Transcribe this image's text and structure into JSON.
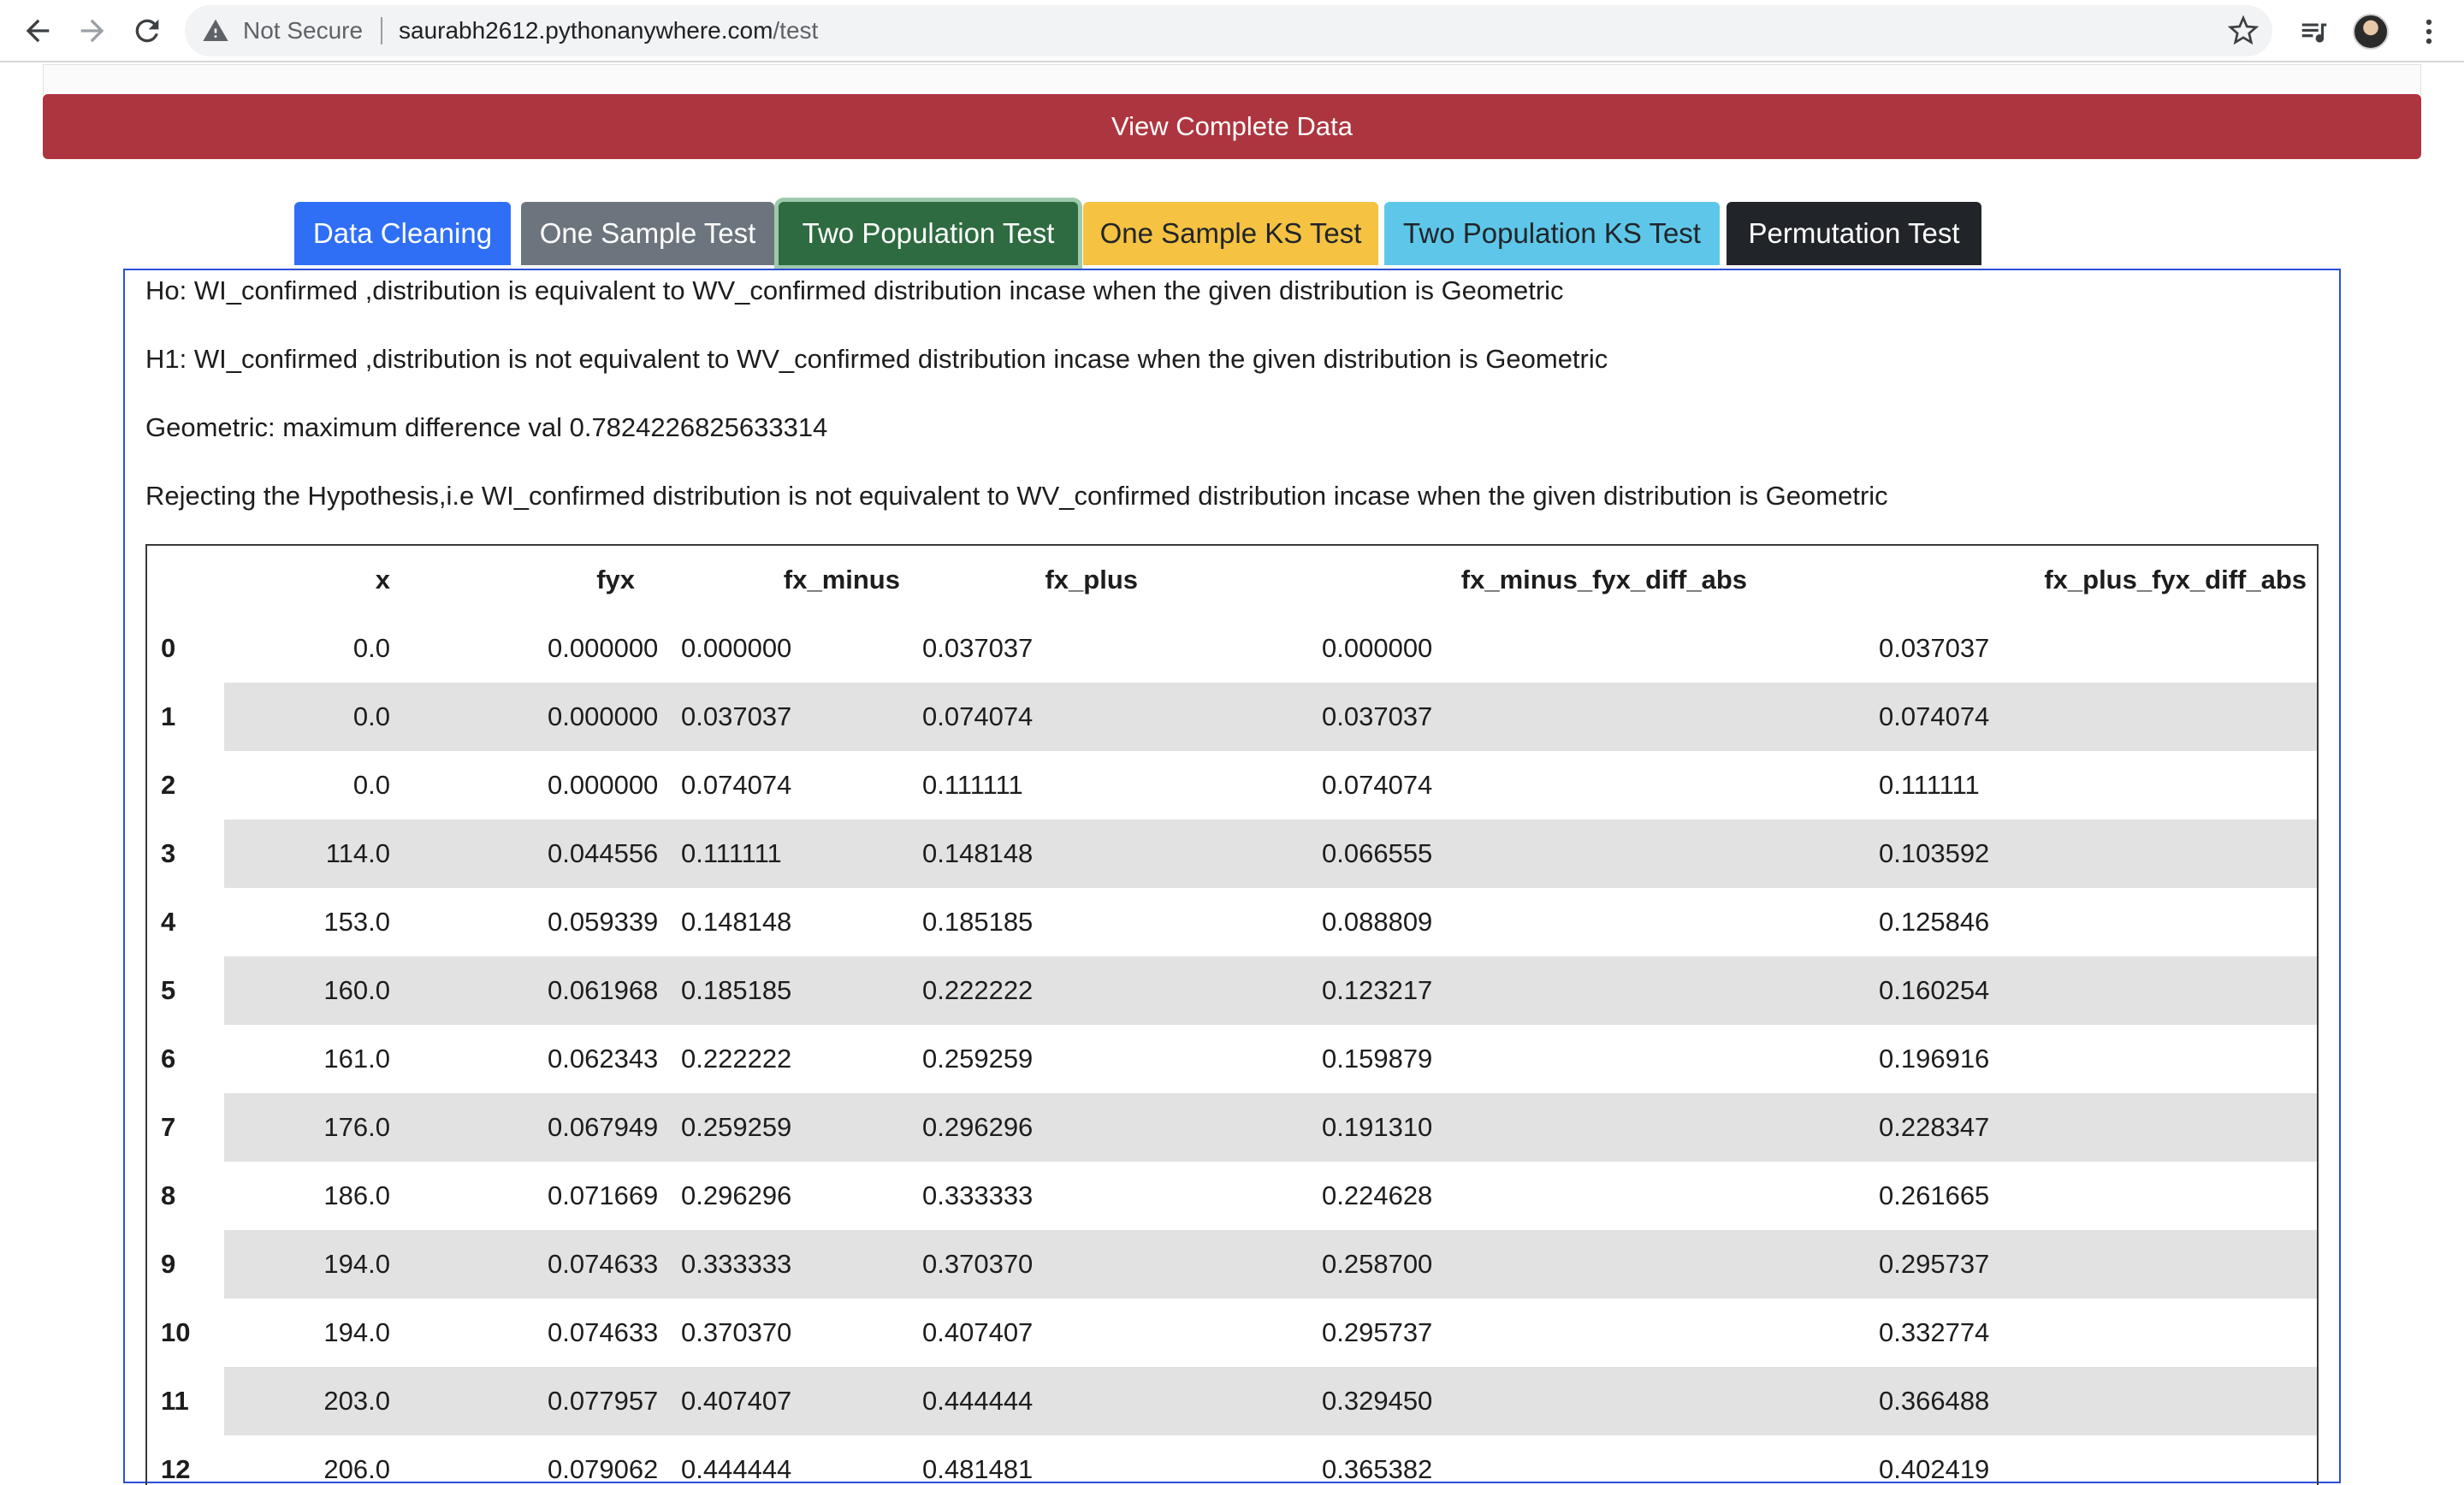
{
  "browser": {
    "not_secure": "Not Secure",
    "url_domain": "saurabh2612.pythonanywhere.com",
    "url_path": "/test",
    "icons": [
      "back-arrow-icon",
      "forward-arrow-icon",
      "reload-icon",
      "warning-icon",
      "star-icon",
      "media-playlist-icon",
      "avatar",
      "more-vert-icon"
    ]
  },
  "page": {
    "view_complete_label": "View Complete Data",
    "tabs": [
      {
        "label": "Data Cleaning",
        "color": "#2f6ff6"
      },
      {
        "label": "One Sample Test",
        "color": "#6c757d"
      },
      {
        "label": "Two Population Test",
        "color": "#2e6b40",
        "active": true
      },
      {
        "label": "One Sample KS Test",
        "color": "#f5c242"
      },
      {
        "label": "Two Population KS Test",
        "color": "#5ec7e9"
      },
      {
        "label": "Permutation Test",
        "color": "#212529"
      }
    ],
    "ho": "Ho: WI_confirmed ,distribution is equivalent to WV_confirmed distribution incase when the given distribution is Geometric",
    "h1": "H1: WI_confirmed ,distribution is not equivalent to WV_confirmed distribution incase when the given distribution is Geometric",
    "geo": "Geometric: maximum difference val 0.7824226825633314",
    "reject": "Rejecting the Hypothesis,i.e WI_confirmed distribution is not equivalent to WV_confirmed distribution incase when the given distribution is Geometric"
  },
  "table": {
    "columns": [
      "",
      "x",
      "fyx",
      "fx_minus",
      "fx_plus",
      "fx_minus_fyx_diff_abs",
      "fx_plus_fyx_diff_abs"
    ],
    "rows": [
      [
        "0",
        "0.0",
        "0.000000",
        "0.000000",
        "0.037037",
        "0.000000",
        "0.037037"
      ],
      [
        "1",
        "0.0",
        "0.000000",
        "0.037037",
        "0.074074",
        "0.037037",
        "0.074074"
      ],
      [
        "2",
        "0.0",
        "0.000000",
        "0.074074",
        "0.111111",
        "0.074074",
        "0.111111"
      ],
      [
        "3",
        "114.0",
        "0.044556",
        "0.111111",
        "0.148148",
        "0.066555",
        "0.103592"
      ],
      [
        "4",
        "153.0",
        "0.059339",
        "0.148148",
        "0.185185",
        "0.088809",
        "0.125846"
      ],
      [
        "5",
        "160.0",
        "0.061968",
        "0.185185",
        "0.222222",
        "0.123217",
        "0.160254"
      ],
      [
        "6",
        "161.0",
        "0.062343",
        "0.222222",
        "0.259259",
        "0.159879",
        "0.196916"
      ],
      [
        "7",
        "176.0",
        "0.067949",
        "0.259259",
        "0.296296",
        "0.191310",
        "0.228347"
      ],
      [
        "8",
        "186.0",
        "0.071669",
        "0.296296",
        "0.333333",
        "0.224628",
        "0.261665"
      ],
      [
        "9",
        "194.0",
        "0.074633",
        "0.333333",
        "0.370370",
        "0.258700",
        "0.295737"
      ],
      [
        "10",
        "194.0",
        "0.074633",
        "0.370370",
        "0.407407",
        "0.295737",
        "0.332774"
      ],
      [
        "11",
        "203.0",
        "0.077957",
        "0.407407",
        "0.444444",
        "0.329450",
        "0.366488"
      ],
      [
        "12",
        "206.0",
        "0.079062",
        "0.444444",
        "0.481481",
        "0.365382",
        "0.402419"
      ]
    ]
  }
}
